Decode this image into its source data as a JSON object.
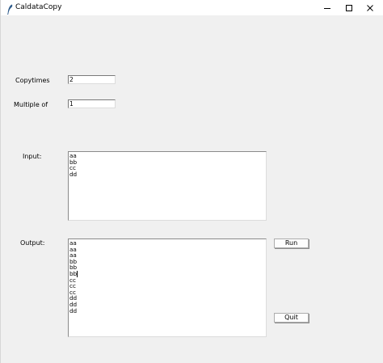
{
  "window": {
    "title": "CaldataCopy",
    "icon": "feather-icon",
    "controls": [
      "minimize-icon",
      "maximize-icon",
      "close-icon"
    ]
  },
  "form": {
    "copytimes_label": "Copytimes",
    "copytimes_value": "2",
    "multiple_label": "Multiple of",
    "multiple_value": "1",
    "input_label": "Input:",
    "output_label": "Output:",
    "input_lines": [
      "aa",
      "bb",
      "cc",
      "dd"
    ],
    "output_lines": [
      "aa",
      "aa",
      "aa",
      "bb",
      "bb",
      "bb",
      "cc",
      "cc",
      "cc",
      "dd",
      "dd",
      "dd"
    ]
  },
  "buttons": {
    "run_label": "Run",
    "quit_label": "Quit"
  }
}
